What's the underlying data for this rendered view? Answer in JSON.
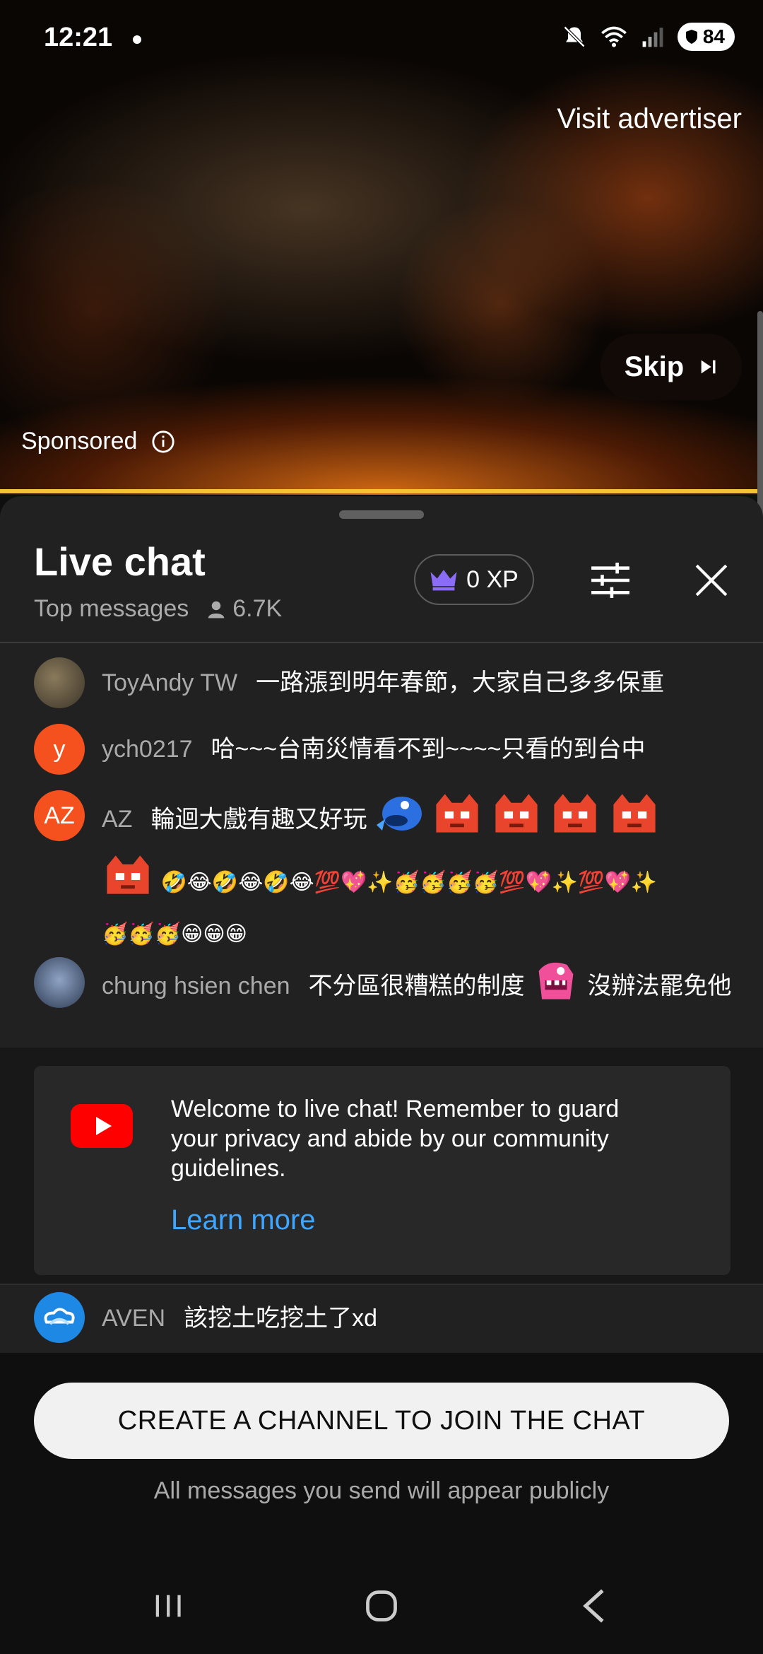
{
  "status_bar": {
    "time": "12:21",
    "battery": "84"
  },
  "ad": {
    "visit_label": "Visit advertiser",
    "skip_label": "Skip",
    "sponsored_label": "Sponsored",
    "progress_color": "#f5c233"
  },
  "chat": {
    "title": "Live chat",
    "mode": "Top messages",
    "viewers": "6.7K",
    "xp": "0 XP",
    "messages": [
      {
        "author": "ToyAndy TW",
        "text": "一路漲到明年春節，大家自己多多保重"
      },
      {
        "author": "ych0217",
        "avatar_letter": "y",
        "text": "哈~~~台南災情看不到~~~~只看的到台中"
      },
      {
        "author": "AZ",
        "avatar_letter": "AZ",
        "text": "輪迴大戲有趣又好玩"
      },
      {
        "author": "chung hsien chen",
        "text_a": "不分區很糟糕的制度",
        "text_b": "沒辦法罷免他"
      }
    ],
    "welcome": {
      "text": "Welcome to live chat! Remember to guard your privacy and abide by our community guidelines.",
      "link": "Learn more"
    },
    "last_message": {
      "author": "AVEN",
      "text": "該挖土吃挖土了xd"
    }
  },
  "create_channel_label": "CREATE A CHANNEL TO JOIN THE CHAT",
  "public_note": "All messages you send will appear publicly",
  "colors": {
    "accent_link": "#3ea6ff",
    "avatar_orange": "#f4511e",
    "yt_red": "#ff0000",
    "crown_purple": "#8b6cf6"
  }
}
